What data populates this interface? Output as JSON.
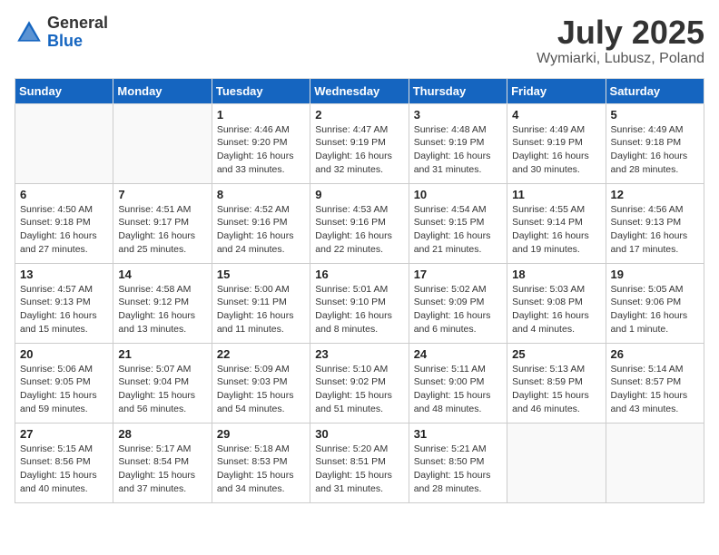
{
  "header": {
    "logo_general": "General",
    "logo_blue": "Blue",
    "month_year": "July 2025",
    "location": "Wymiarki, Lubusz, Poland"
  },
  "days_of_week": [
    "Sunday",
    "Monday",
    "Tuesday",
    "Wednesday",
    "Thursday",
    "Friday",
    "Saturday"
  ],
  "weeks": [
    [
      {
        "day": "",
        "content": ""
      },
      {
        "day": "",
        "content": ""
      },
      {
        "day": "1",
        "content": "Sunrise: 4:46 AM\nSunset: 9:20 PM\nDaylight: 16 hours\nand 33 minutes."
      },
      {
        "day": "2",
        "content": "Sunrise: 4:47 AM\nSunset: 9:19 PM\nDaylight: 16 hours\nand 32 minutes."
      },
      {
        "day": "3",
        "content": "Sunrise: 4:48 AM\nSunset: 9:19 PM\nDaylight: 16 hours\nand 31 minutes."
      },
      {
        "day": "4",
        "content": "Sunrise: 4:49 AM\nSunset: 9:19 PM\nDaylight: 16 hours\nand 30 minutes."
      },
      {
        "day": "5",
        "content": "Sunrise: 4:49 AM\nSunset: 9:18 PM\nDaylight: 16 hours\nand 28 minutes."
      }
    ],
    [
      {
        "day": "6",
        "content": "Sunrise: 4:50 AM\nSunset: 9:18 PM\nDaylight: 16 hours\nand 27 minutes."
      },
      {
        "day": "7",
        "content": "Sunrise: 4:51 AM\nSunset: 9:17 PM\nDaylight: 16 hours\nand 25 minutes."
      },
      {
        "day": "8",
        "content": "Sunrise: 4:52 AM\nSunset: 9:16 PM\nDaylight: 16 hours\nand 24 minutes."
      },
      {
        "day": "9",
        "content": "Sunrise: 4:53 AM\nSunset: 9:16 PM\nDaylight: 16 hours\nand 22 minutes."
      },
      {
        "day": "10",
        "content": "Sunrise: 4:54 AM\nSunset: 9:15 PM\nDaylight: 16 hours\nand 21 minutes."
      },
      {
        "day": "11",
        "content": "Sunrise: 4:55 AM\nSunset: 9:14 PM\nDaylight: 16 hours\nand 19 minutes."
      },
      {
        "day": "12",
        "content": "Sunrise: 4:56 AM\nSunset: 9:13 PM\nDaylight: 16 hours\nand 17 minutes."
      }
    ],
    [
      {
        "day": "13",
        "content": "Sunrise: 4:57 AM\nSunset: 9:13 PM\nDaylight: 16 hours\nand 15 minutes."
      },
      {
        "day": "14",
        "content": "Sunrise: 4:58 AM\nSunset: 9:12 PM\nDaylight: 16 hours\nand 13 minutes."
      },
      {
        "day": "15",
        "content": "Sunrise: 5:00 AM\nSunset: 9:11 PM\nDaylight: 16 hours\nand 11 minutes."
      },
      {
        "day": "16",
        "content": "Sunrise: 5:01 AM\nSunset: 9:10 PM\nDaylight: 16 hours\nand 8 minutes."
      },
      {
        "day": "17",
        "content": "Sunrise: 5:02 AM\nSunset: 9:09 PM\nDaylight: 16 hours\nand 6 minutes."
      },
      {
        "day": "18",
        "content": "Sunrise: 5:03 AM\nSunset: 9:08 PM\nDaylight: 16 hours\nand 4 minutes."
      },
      {
        "day": "19",
        "content": "Sunrise: 5:05 AM\nSunset: 9:06 PM\nDaylight: 16 hours\nand 1 minute."
      }
    ],
    [
      {
        "day": "20",
        "content": "Sunrise: 5:06 AM\nSunset: 9:05 PM\nDaylight: 15 hours\nand 59 minutes."
      },
      {
        "day": "21",
        "content": "Sunrise: 5:07 AM\nSunset: 9:04 PM\nDaylight: 15 hours\nand 56 minutes."
      },
      {
        "day": "22",
        "content": "Sunrise: 5:09 AM\nSunset: 9:03 PM\nDaylight: 15 hours\nand 54 minutes."
      },
      {
        "day": "23",
        "content": "Sunrise: 5:10 AM\nSunset: 9:02 PM\nDaylight: 15 hours\nand 51 minutes."
      },
      {
        "day": "24",
        "content": "Sunrise: 5:11 AM\nSunset: 9:00 PM\nDaylight: 15 hours\nand 48 minutes."
      },
      {
        "day": "25",
        "content": "Sunrise: 5:13 AM\nSunset: 8:59 PM\nDaylight: 15 hours\nand 46 minutes."
      },
      {
        "day": "26",
        "content": "Sunrise: 5:14 AM\nSunset: 8:57 PM\nDaylight: 15 hours\nand 43 minutes."
      }
    ],
    [
      {
        "day": "27",
        "content": "Sunrise: 5:15 AM\nSunset: 8:56 PM\nDaylight: 15 hours\nand 40 minutes."
      },
      {
        "day": "28",
        "content": "Sunrise: 5:17 AM\nSunset: 8:54 PM\nDaylight: 15 hours\nand 37 minutes."
      },
      {
        "day": "29",
        "content": "Sunrise: 5:18 AM\nSunset: 8:53 PM\nDaylight: 15 hours\nand 34 minutes."
      },
      {
        "day": "30",
        "content": "Sunrise: 5:20 AM\nSunset: 8:51 PM\nDaylight: 15 hours\nand 31 minutes."
      },
      {
        "day": "31",
        "content": "Sunrise: 5:21 AM\nSunset: 8:50 PM\nDaylight: 15 hours\nand 28 minutes."
      },
      {
        "day": "",
        "content": ""
      },
      {
        "day": "",
        "content": ""
      }
    ]
  ]
}
